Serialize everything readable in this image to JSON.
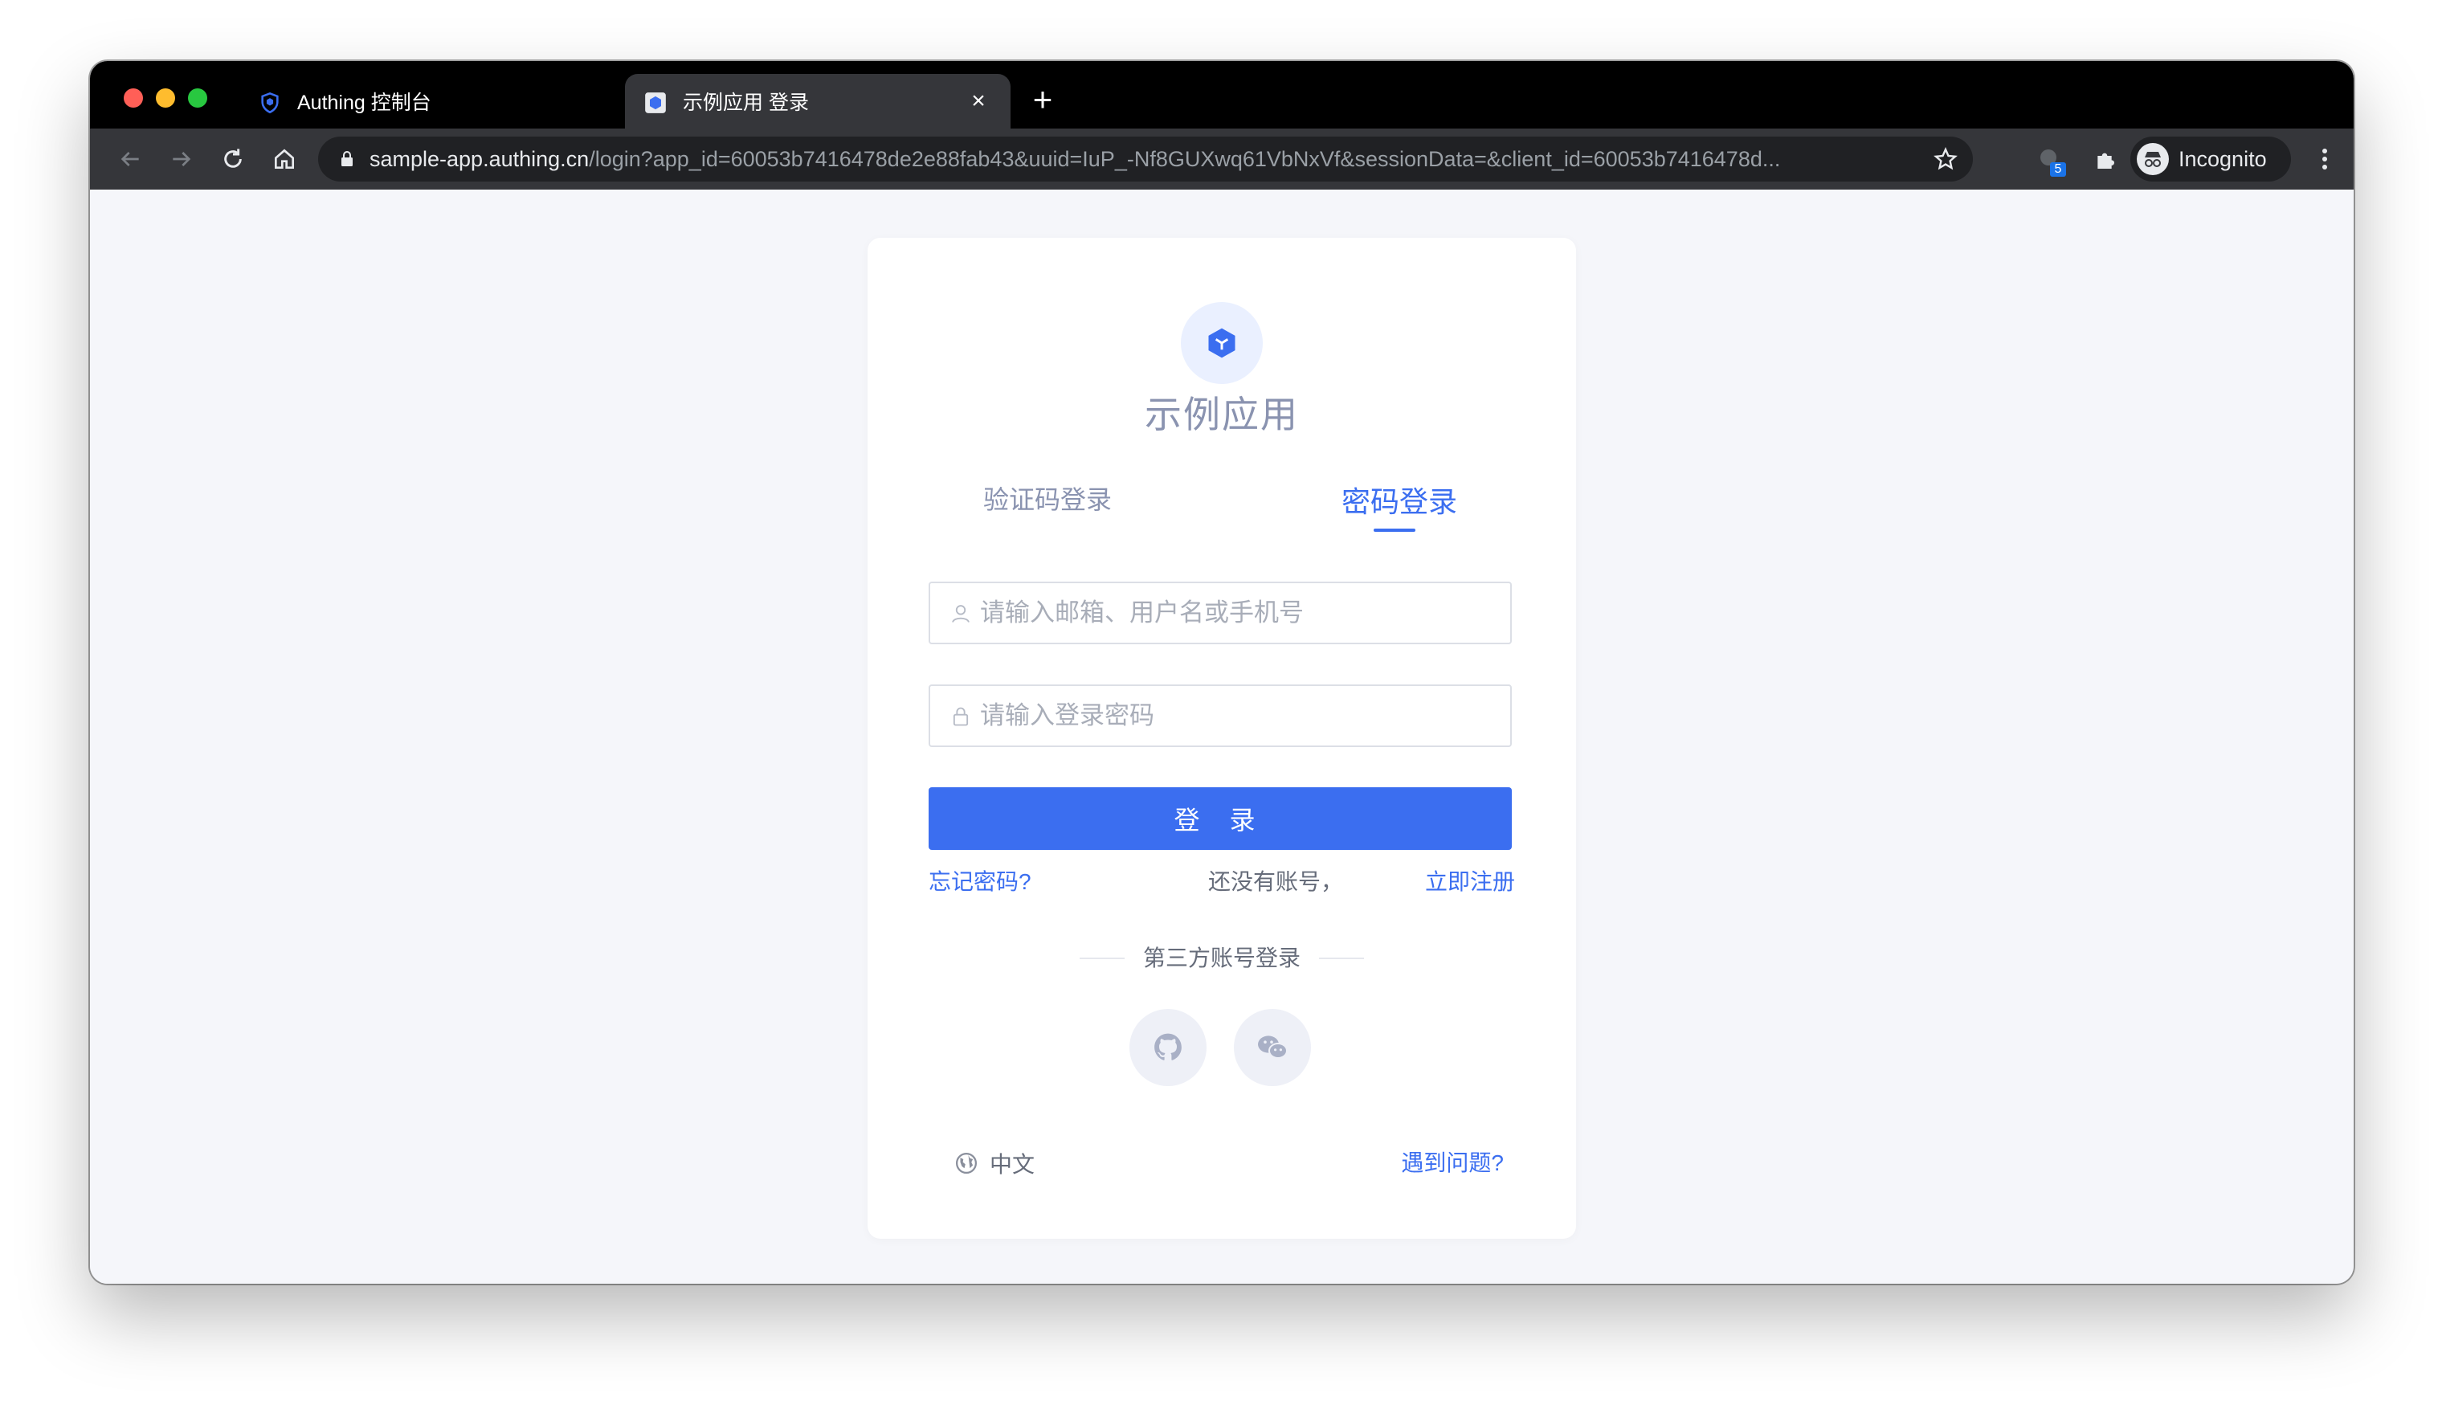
{
  "browser": {
    "tabs": [
      {
        "title": "Authing 控制台",
        "active": false
      },
      {
        "title": "示例应用 登录",
        "active": true
      }
    ],
    "url_host": "sample-app.authing.cn",
    "url_path": "/login?app_id=60053b7416478de2e88fab43&uuid=IuP_-Nf8GUXwq61VbNxVf&sessionData=&client_id=60053b7416478d...",
    "extension_badge": "5",
    "profile_label": "Incognito",
    "new_tab_symbol": "+",
    "close_symbol": "×"
  },
  "login": {
    "app_name": "示例应用",
    "tab_code": "验证码登录",
    "tab_password": "密码登录",
    "account_placeholder": "请输入邮箱、用户名或手机号",
    "password_placeholder": "请输入登录密码",
    "login_button": "登 录",
    "forgot_password": "忘记密码?",
    "no_account": "还没有账号，",
    "register": "立即注册",
    "third_party": "第三方账号登录",
    "language": "中文",
    "help": "遇到问题?"
  },
  "colors": {
    "accent": "#3b6ef0",
    "page_bg": "#f5f6fa",
    "chrome_dark": "#35363a"
  },
  "icons": [
    "shield-icon",
    "app-cube-icon",
    "back-icon",
    "forward-icon",
    "reload-icon",
    "home-icon",
    "lock-icon",
    "star-icon",
    "extensions-icon",
    "incognito-icon",
    "menu-icon",
    "user-icon",
    "padlock-icon",
    "github-icon",
    "wechat-icon",
    "globe-icon"
  ]
}
